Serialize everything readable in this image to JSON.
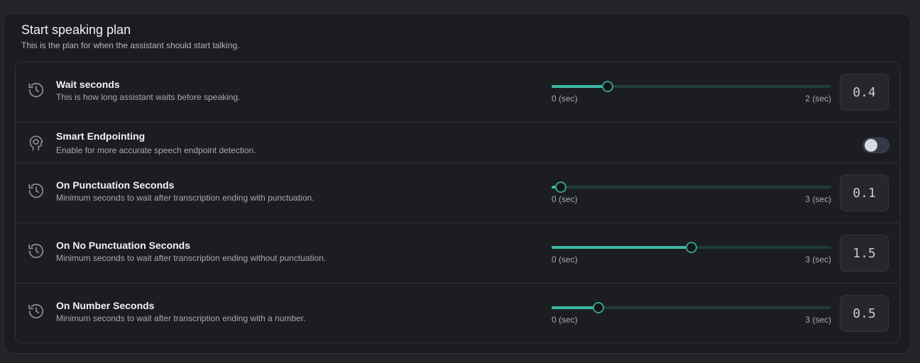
{
  "section": {
    "title": "Start speaking plan",
    "description": "This is the plan for when the assistant should start talking."
  },
  "rows": [
    {
      "title": "Wait seconds",
      "description": "This is how long assistant waits before speaking.",
      "icon": "history-icon",
      "min_label": "0 (sec)",
      "max_label": "2 (sec)",
      "min": 0,
      "max": 2,
      "value": 0.4,
      "value_label": "0.4"
    },
    {
      "title": "Smart Endpointing",
      "description": "Enable for more accurate speech endpoint detection.",
      "icon": "brain-head-icon",
      "toggle_on": false
    },
    {
      "title": "On Punctuation Seconds",
      "description": "Minimum seconds to wait after transcription ending with punctuation.",
      "icon": "history-icon",
      "min_label": "0 (sec)",
      "max_label": "3 (sec)",
      "min": 0,
      "max": 3,
      "value": 0.1,
      "value_label": "0.1"
    },
    {
      "title": "On No Punctuation Seconds",
      "description": "Minimum seconds to wait after transcription ending without punctuation.",
      "icon": "history-icon",
      "min_label": "0 (sec)",
      "max_label": "3 (sec)",
      "min": 0,
      "max": 3,
      "value": 1.5,
      "value_label": "1.5"
    },
    {
      "title": "On Number Seconds",
      "description": "Minimum seconds to wait after transcription ending with a number.",
      "icon": "history-icon",
      "min_label": "0 (sec)",
      "max_label": "3 (sec)",
      "min": 0,
      "max": 3,
      "value": 0.5,
      "value_label": "0.5"
    }
  ],
  "colors": {
    "accent": "#3bb9a4",
    "track": "#1f3d37",
    "toggle_off": "#343848"
  }
}
